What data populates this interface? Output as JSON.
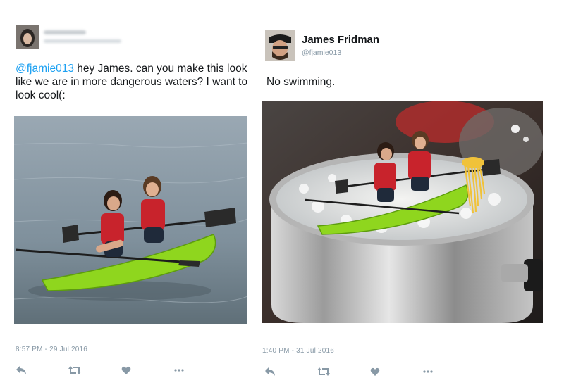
{
  "left_tweet": {
    "text_parts": {
      "mention": "@fjamie013",
      "body": " hey James. can you make this look like we are in more dangerous waters? I want to look cool(:"
    },
    "timestamp": "8:57 PM - 29 Jul 2016",
    "photo_icon": "kayak-photo"
  },
  "right_tweet": {
    "name": "James Fridman",
    "handle": "@fjamie013",
    "text": "No swimming.",
    "timestamp": "1:40 PM - 31 Jul 2016",
    "photo_icon": "pot-kayak-photo"
  },
  "icons": {
    "reply": "reply-icon",
    "retweet": "retweet-icon",
    "like": "heart-icon",
    "more": "more-icon"
  },
  "colors": {
    "mention": "#1da1f2",
    "action_icon": "#8899a6",
    "kayak": "#8fd61e",
    "lifejacket": "#c8232c"
  }
}
